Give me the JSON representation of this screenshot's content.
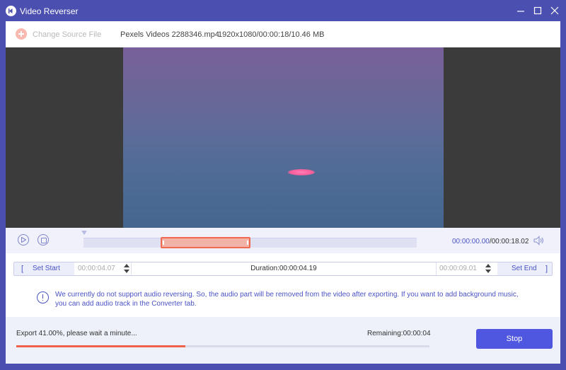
{
  "window": {
    "title": "Video Reverser",
    "accent": "#4a4fb0"
  },
  "filebar": {
    "change_source": "Change Source File",
    "file_name": "Pexels Videos 2288346.mp4",
    "file_meta": "1920x1080/00:00:18/10.46 MB"
  },
  "playback": {
    "current_time": "00:00:00.00",
    "total_time": "/00:00:18.02",
    "selection_start_fraction": 0.2305,
    "selection_end_fraction": 0.5,
    "playhead_fraction": 0.0
  },
  "trim": {
    "set_start_label": "Set Start",
    "start_bracket": "[",
    "start_time": "00:00:04.07",
    "duration": "Duration:00:00:04.19",
    "end_time": "00:00:09.01",
    "set_end_label": "Set End",
    "end_bracket": "]"
  },
  "notice": {
    "text": "We currently do not support audio reversing. So, the audio part will be removed from the video after exporting. If you want to add background music, you can add audio track in the Converter tab."
  },
  "export": {
    "status": "Export 41.00%, please wait a minute...",
    "remaining": "Remaining:00:00:04",
    "progress_percent": 41,
    "stop_label": "Stop",
    "progress_color": "#f0614a",
    "button_color": "#4f56e0"
  },
  "icons": [
    "app-logo-icon",
    "minimize-icon",
    "maximize-icon",
    "close-icon",
    "add-icon",
    "play-icon",
    "stop-icon",
    "volume-icon",
    "info-icon"
  ]
}
